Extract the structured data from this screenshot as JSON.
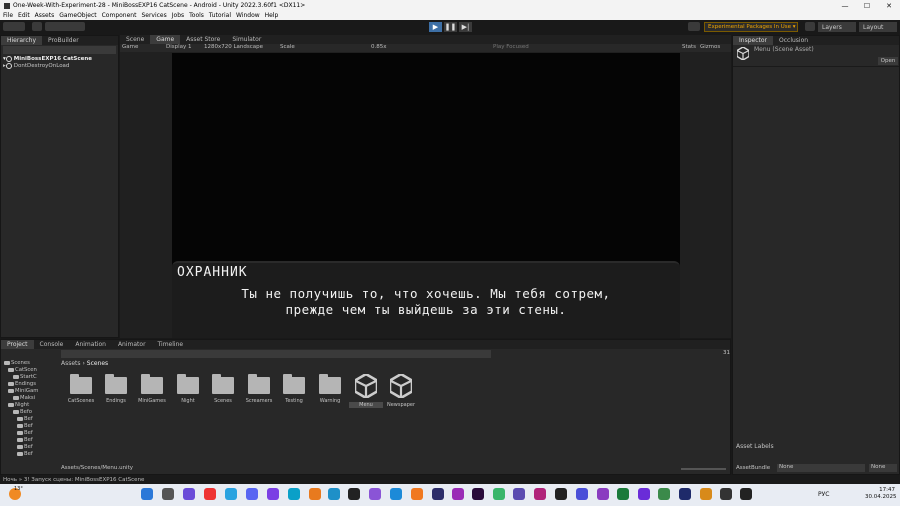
{
  "window": {
    "title": "One-Week-With-Experiment-28 - MiniBossEXP16 CatScene - Android - Unity 2022.3.60f1 <DX11>"
  },
  "menu": [
    "File",
    "Edit",
    "Assets",
    "GameObject",
    "Component",
    "Services",
    "Jobs",
    "Tools",
    "Tutorial",
    "Window",
    "Help"
  ],
  "toolbar": {
    "exp_packages": "Experimental Packages In Use ▾",
    "layers": "Layers",
    "layout": "Layout"
  },
  "hierarchy": {
    "tabs": [
      "Hierarchy",
      "ProBuilder"
    ],
    "scene": "MiniBossEXP16 CatScene",
    "dontdestroy": "DontDestroyOnLoad"
  },
  "game": {
    "tabs": [
      "Scene",
      "Game",
      "Asset Store",
      "Simulator"
    ],
    "mode": "Game",
    "display": "Display 1",
    "resolution": "1280x720 Landscape",
    "scale_label": "Scale",
    "scale_value": "0.85x",
    "play_focused": "Play Focused",
    "stats": "Stats",
    "gizmos": "Gizmos"
  },
  "dialogue": {
    "speaker": "ОХРАННИК",
    "line1": "Ты не получишь то, что хочешь. Мы тебя сотрем,",
    "line2": "прежде чем ты выйдешь за эти стены."
  },
  "inspector": {
    "tabs": [
      "Inspector",
      "Occlusion"
    ],
    "asset_name": "Menu (Scene Asset)",
    "open": "Open",
    "labels": "Asset Labels",
    "bundle_label": "AssetBundle",
    "bundle_value": "None",
    "variant_value": "None"
  },
  "project": {
    "tabs": [
      "Project",
      "Console",
      "Animation",
      "Animator",
      "Timeline"
    ],
    "breadcrumb_root": "Assets",
    "breadcrumb_current": "Scenes",
    "count": "31",
    "path": "Assets/Scenes/Menu.unity",
    "tree": [
      "Scenes",
      "CatScen",
      "StartC",
      "Endings",
      "MiniGam",
      "Maksi",
      "Night",
      "Befo",
      "Bef",
      "Bef",
      "Bef",
      "Bef",
      "Bef",
      "Bef"
    ],
    "assets": [
      "CatScenes",
      "Endings",
      "MiniGames",
      "Night",
      "Scenes",
      "Screamers",
      "Testing",
      "Warning",
      "Menu",
      "Newspaper"
    ]
  },
  "status": {
    "text": "Ночь » 3! Запуск сцены: MiniBossEXP16 CatScene"
  },
  "taskbar": {
    "temp": "13°",
    "lang": "РУС",
    "time": "17:47",
    "date": "30.04.2025"
  }
}
